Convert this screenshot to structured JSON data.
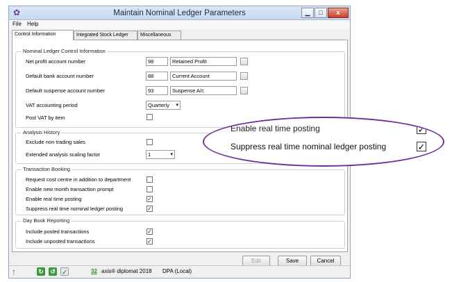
{
  "window": {
    "title": "Maintain Nominal Ledger Parameters"
  },
  "menu": [
    "File",
    "Help"
  ],
  "tabs": [
    "Control Information",
    "Integrated Stock Ledger",
    "Miscellaneous"
  ],
  "nominal_ledger": {
    "group_title": "Nominal Ledger Control Information",
    "net_profit": {
      "label": "Net profit account number",
      "code": "98",
      "name": "Retained Profit"
    },
    "bank": {
      "label": "Default bank account number",
      "code": "88",
      "name": "Current Account"
    },
    "suspense": {
      "label": "Default suspense account number",
      "code": "93",
      "name": "Suspense A/c"
    },
    "vat_period": {
      "label": "VAT accounting period",
      "value": "Quarterly"
    },
    "post_vat": {
      "label": "Post VAT by item",
      "checked": false
    }
  },
  "analysis_history": {
    "group_title": "Analysis History",
    "exclude_non_trading": {
      "label": "Exclude non trading sales",
      "checked": false
    },
    "scaling_factor": {
      "label": "Extended analysis scaling factor",
      "value": "1"
    }
  },
  "transaction_booking": {
    "group_title": "Transaction Booking",
    "items": [
      {
        "label": "Request cost centre in addition to department",
        "checked": false
      },
      {
        "label": "Enable new month transaction prompt",
        "checked": false
      },
      {
        "label": "Enable real time posting",
        "checked": true
      },
      {
        "label": "Suppress real time nominal ledger posting",
        "checked": true
      }
    ]
  },
  "day_book": {
    "group_title": "Day Book Reporting",
    "items": [
      {
        "label": "Include posted transactions",
        "checked": true
      },
      {
        "label": "Include unposted transactions",
        "checked": true
      }
    ]
  },
  "buttons": {
    "edit": "Edit",
    "save": "Save",
    "cancel": "Cancel"
  },
  "status": {
    "number": "32",
    "product": "axis® diplomat 2018",
    "server": "DPA (Local)"
  },
  "callout": {
    "line1": "Enable real time posting",
    "line2": "Suppress real time nominal ledger posting",
    "check_glyph": "✓"
  },
  "colors": {
    "accent": "#6f2f9a"
  }
}
